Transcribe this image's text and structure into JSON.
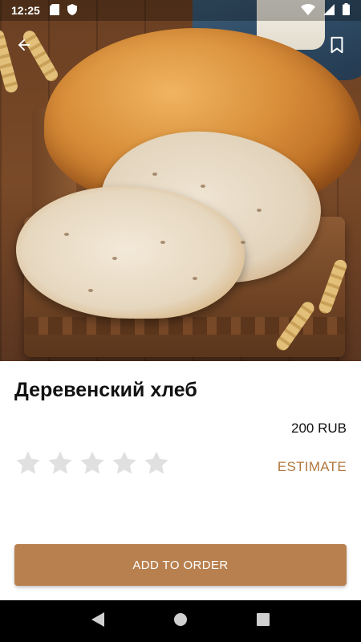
{
  "status_bar": {
    "time": "12:25",
    "left_icons": [
      "sd-card-icon",
      "shield-icon"
    ],
    "right_icons": [
      "wifi-icon",
      "cell-signal-icon",
      "battery-icon"
    ]
  },
  "toolbar": {
    "back_icon": "arrow-left-icon",
    "bookmark_icon": "bookmark-icon"
  },
  "product": {
    "title": "Деревенский хлеб",
    "price": "200 RUB",
    "rating": {
      "value": 0,
      "max": 5
    }
  },
  "actions": {
    "estimate_label": "ESTIMATE",
    "add_to_order_label": "ADD TO ORDER"
  },
  "colors": {
    "accent": "#b0773e",
    "button": "#b8804f",
    "star_empty": "#e0e0e0"
  },
  "nav_bar": {
    "buttons": [
      "back-triangle-icon",
      "home-circle-icon",
      "recents-square-icon"
    ]
  }
}
